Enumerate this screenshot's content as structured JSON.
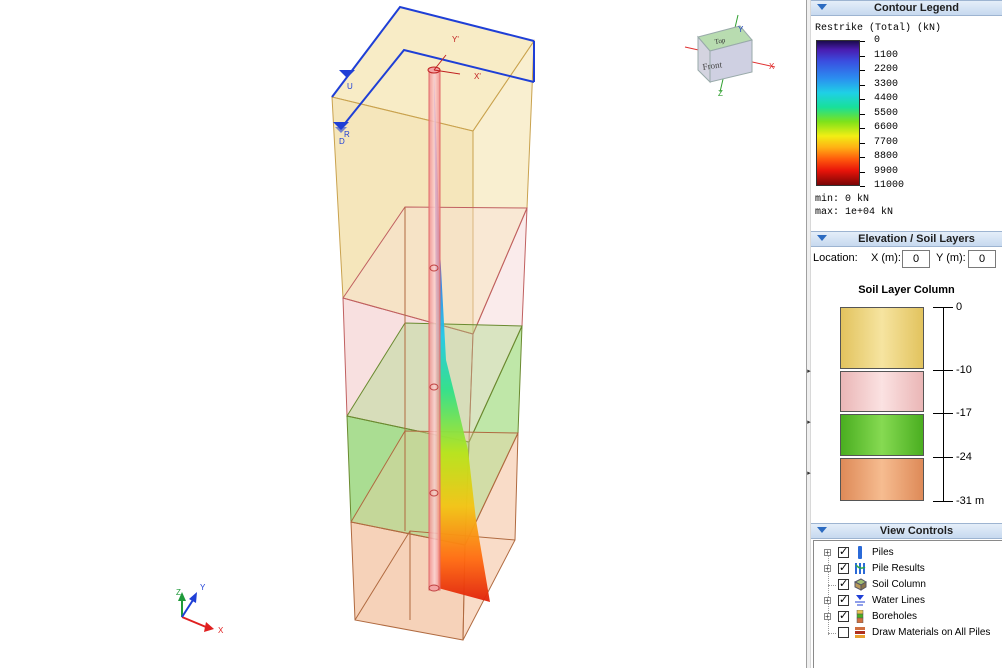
{
  "viewport": {
    "cube": {
      "top_label": "Top",
      "front_label": "Front",
      "axis_x": "X",
      "axis_y": "Y",
      "axis_z": "Z"
    },
    "triad": {
      "x": "X",
      "y": "Y",
      "z": "Z"
    },
    "model_labels": {
      "y_prime": "Y'",
      "x_prime": "X'",
      "u_marker": "U",
      "r_marker": "R",
      "d_marker": "D"
    }
  },
  "contour_legend": {
    "header": "Contour Legend",
    "title": "Restrike (Total) (kN)",
    "levels": [
      "0",
      "1100",
      "2200",
      "3300",
      "4400",
      "5500",
      "6600",
      "7700",
      "8800",
      "9900",
      "11000"
    ],
    "min": "min: 0 kN",
    "max": "max: 1e+04 kN"
  },
  "elevation": {
    "header": "Elevation / Soil Layers",
    "location_label": "Location:",
    "x_label": "X (m):",
    "x_value": "0",
    "y_label": "Y (m):",
    "y_value": "0",
    "column_title": "Soil Layer Column",
    "depth_labels": [
      "0",
      "-10",
      "-17",
      "-24",
      "-31 m"
    ],
    "layer_colors": [
      "#e8cd6c",
      "#f2c8c8",
      "#59be2b",
      "#e89766"
    ]
  },
  "view_controls": {
    "header": "View Controls",
    "items": [
      {
        "label": "Piles",
        "checked": true,
        "expandable": true,
        "icon": "pile-icon"
      },
      {
        "label": "Pile Results",
        "checked": true,
        "expandable": true,
        "icon": "pile-results-icon"
      },
      {
        "label": "Soil Column",
        "checked": true,
        "expandable": false,
        "icon": "soil-column-icon"
      },
      {
        "label": "Water Lines",
        "checked": true,
        "expandable": true,
        "icon": "water-lines-icon"
      },
      {
        "label": "Boreholes",
        "checked": true,
        "expandable": true,
        "icon": "boreholes-icon"
      },
      {
        "label": "Draw Materials on All Piles",
        "checked": false,
        "expandable": false,
        "icon": "materials-icon"
      }
    ]
  },
  "colors": {
    "frame_blue": "#1f3fd6",
    "panel_header": "#c7d9ef",
    "accent_red": "#e02020"
  }
}
